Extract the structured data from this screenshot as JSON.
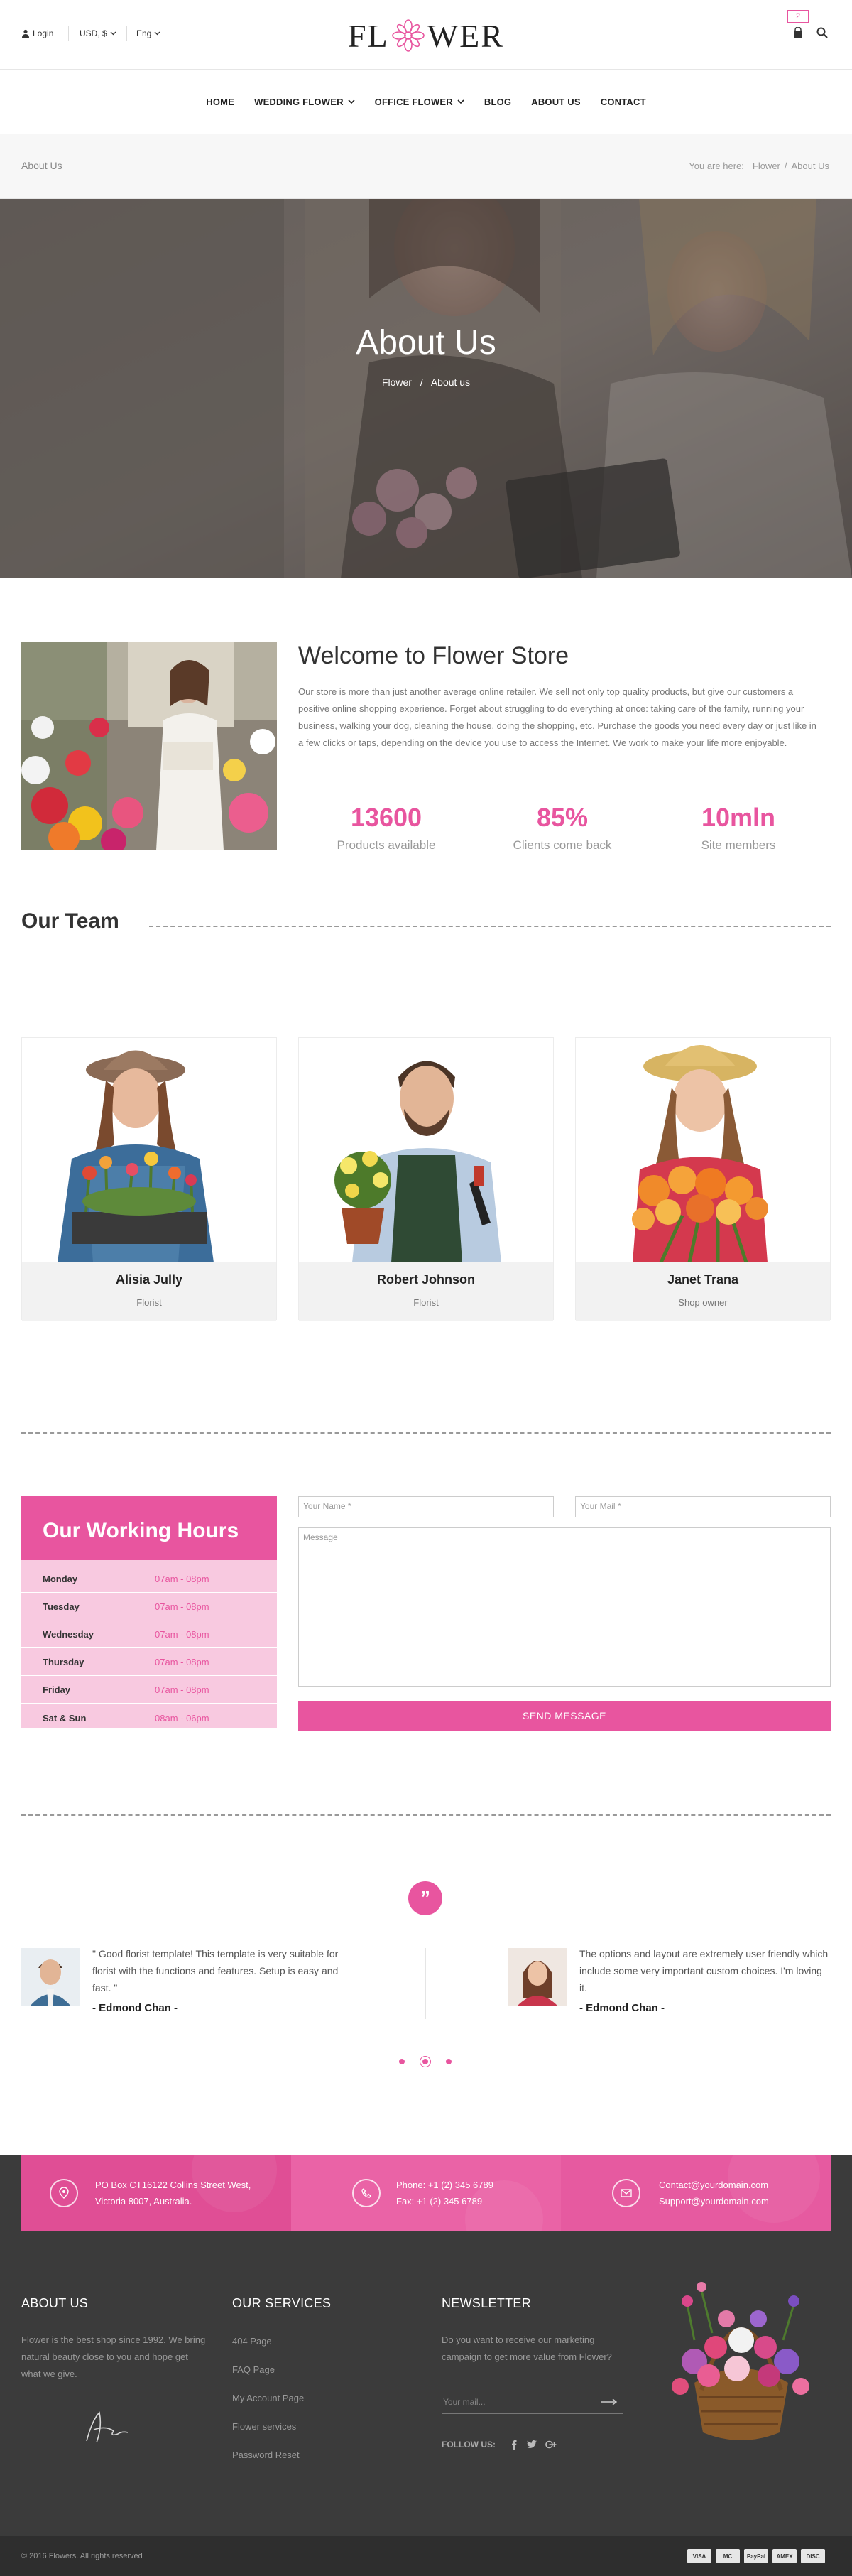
{
  "topbar": {
    "login": "Login",
    "currency": "USD, $",
    "language": "Eng",
    "logo": "FLOWER",
    "cart_count": "2"
  },
  "nav": [
    {
      "label": "HOME",
      "dropdown": false
    },
    {
      "label": "WEDDING FLOWER",
      "dropdown": true
    },
    {
      "label": "OFFICE FLOWER",
      "dropdown": true
    },
    {
      "label": "BLOG",
      "dropdown": false
    },
    {
      "label": "ABOUT US",
      "dropdown": false
    },
    {
      "label": "CONTACT",
      "dropdown": false
    }
  ],
  "crumbbar": {
    "page": "About Us",
    "prefix": "You are here:",
    "home": "Flower",
    "separator": "/",
    "current": "About Us"
  },
  "hero": {
    "title": "About Us",
    "crumb_home": "Flower",
    "crumb_sep": "/",
    "crumb_current": "About us"
  },
  "welcome": {
    "title": "Welcome to Flower Store",
    "text": "Our store is more than just another average online retailer. We sell not only top quality products, but give our customers a positive online shopping experience. Forget about struggling to do everything at once: taking care of the family, running your business, walking your dog, cleaning the house, doing the shopping, etc. Purchase the goods you need every day or just like in a few clicks or taps, depending on the device you use to access the Internet. We work to make your life more enjoyable.",
    "stats": [
      {
        "value": "13600",
        "label": "Products available"
      },
      {
        "value": "85%",
        "label": "Clients come back"
      },
      {
        "value": "10mln",
        "label": "Site members"
      }
    ]
  },
  "team": {
    "title": "Our Team",
    "members": [
      {
        "name": "Alisia Jully",
        "role": "Florist"
      },
      {
        "name": "Robert Johnson",
        "role": "Florist"
      },
      {
        "name": "Janet Trana",
        "role": "Shop owner"
      }
    ]
  },
  "hours": {
    "title": "Our Working Hours",
    "rows": [
      {
        "day": "Monday",
        "time": "07am - 08pm"
      },
      {
        "day": "Tuesday",
        "time": "07am - 08pm"
      },
      {
        "day": "Wednesday",
        "time": "07am - 08pm"
      },
      {
        "day": "Thursday",
        "time": "07am - 08pm"
      },
      {
        "day": "Friday",
        "time": "07am - 08pm"
      },
      {
        "day": "Sat & Sun",
        "time": "08am - 06pm"
      }
    ]
  },
  "form": {
    "name_placeholder": "Your Name *",
    "mail_placeholder": "Your Mail *",
    "message_placeholder": "Message",
    "submit": "SEND MESSAGE"
  },
  "testimonials": [
    {
      "text": "\" Good florist template! This template is very suitable for florist with the functions and features. Setup is easy and fast. \"",
      "author": "- Edmond Chan -"
    },
    {
      "text": "The options and layout are extremely user friendly which include some very important custom choices. I'm loving it.",
      "author": "- Edmond Chan -"
    }
  ],
  "contact": {
    "address_line1": "PO Box CT16122 Collins Street West,",
    "address_line2": "Victoria 8007, Australia.",
    "phone": "Phone: +1 (2) 345 6789",
    "fax": "Fax: +1 (2) 345 6789",
    "email1": "Contact@yourdomain.com",
    "email2": "Support@yourdomain.com"
  },
  "footer": {
    "about_title": "ABOUT US",
    "about_text": "Flower is the best shop since 1992. We bring natural beauty close to you and hope get what we give.",
    "services_title": "OUR SERVICES",
    "services": [
      "404 Page",
      "FAQ Page",
      "My Account Page",
      "Flower services",
      "Password Reset"
    ],
    "newsletter_title": "NEWSLETTER",
    "newsletter_text": "Do you want to receive our marketing campaign to get more value from Flower?",
    "newsletter_placeholder": "Your mail...",
    "follow_label": "FOLLOW US:",
    "copyright": "© 2016 Flowers. All rights reserved",
    "payments": [
      "VISA",
      "MC",
      "PayPal",
      "AMEX",
      "DISC"
    ]
  },
  "colors": {
    "accent": "#e8559f",
    "hours_bg": "#f8c9e0",
    "footer_bg": "#3b3b3b",
    "bottom_bar": "#2e2e2e"
  }
}
